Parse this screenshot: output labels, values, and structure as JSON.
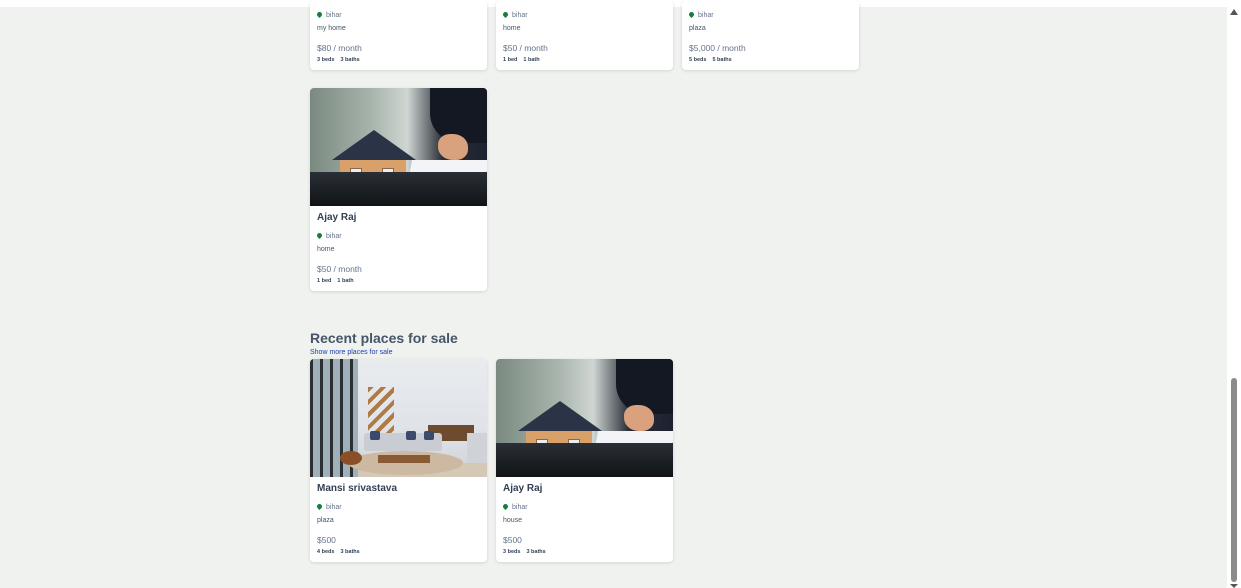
{
  "top_row": [
    {
      "location": "bihar",
      "description": "my home",
      "price": "$80 / month",
      "beds": "3 beds",
      "baths": "3 baths"
    },
    {
      "location": "bihar",
      "description": "home",
      "price": "$50 / month",
      "beds": "1 bed",
      "baths": "1 bath"
    },
    {
      "location": "bihar",
      "description": "plaza",
      "price": "$5,000 / month",
      "beds": "5 beds",
      "baths": "5 baths"
    }
  ],
  "rent_card": {
    "title": "Ajay Raj",
    "location": "bihar",
    "description": "home",
    "price": "$50 / month",
    "beds": "1 bed",
    "baths": "1 bath",
    "image": "house-model-contract"
  },
  "sale_section": {
    "title": "Recent places for sale",
    "link": "Show more places for sale",
    "cards": [
      {
        "title": "Mansi srivastava",
        "location": "bihar",
        "description": "plaza",
        "price": "$500",
        "beds": "4 beds",
        "baths": "3 baths",
        "image": "living-room"
      },
      {
        "title": "Ajay Raj",
        "location": "bihar",
        "description": "house",
        "price": "$500",
        "beds": "3 beds",
        "baths": "3 baths",
        "image": "house-model-contract"
      }
    ]
  },
  "colors": {
    "page_bg": "#eff2ef",
    "pin": "#15803d",
    "link": "#1e40af"
  },
  "icons": {
    "location": "map-pin-icon"
  }
}
